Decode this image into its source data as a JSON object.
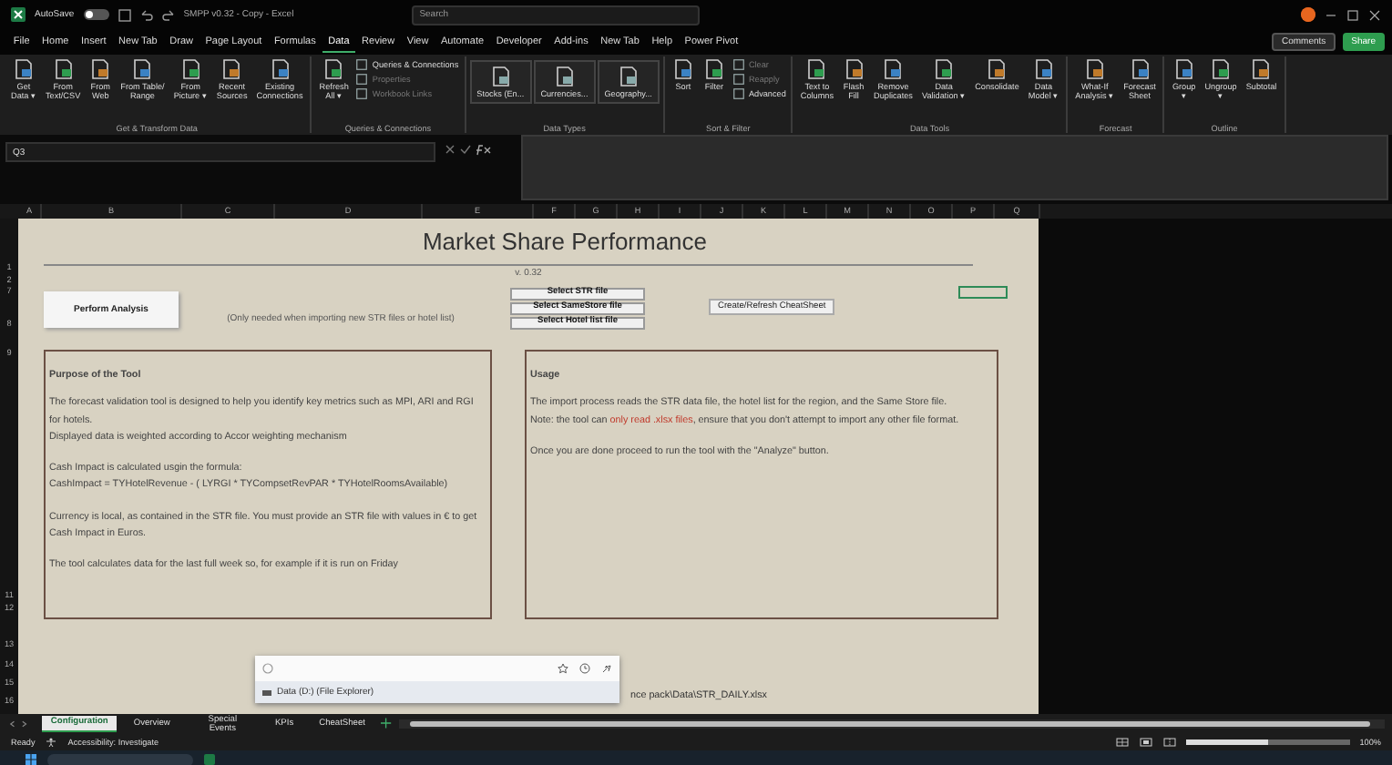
{
  "title_bar": {
    "autosave": {
      "label": "AutoSave",
      "on": false
    },
    "title": "SMPP v0.32 - Copy - Excel",
    "search": {
      "placeholder": "Search"
    }
  },
  "menu": {
    "tabs": [
      {
        "label": "File",
        "selected": false
      },
      {
        "label": "Home",
        "selected": false
      },
      {
        "label": "Insert",
        "selected": false
      },
      {
        "label": "New Tab",
        "selected": false
      },
      {
        "label": "Draw",
        "selected": false
      },
      {
        "label": "Page Layout",
        "selected": false
      },
      {
        "label": "Formulas",
        "selected": false
      },
      {
        "label": "Data",
        "selected": true
      },
      {
        "label": "Review",
        "selected": false
      },
      {
        "label": "View",
        "selected": false
      },
      {
        "label": "Automate",
        "selected": false
      },
      {
        "label": "Developer",
        "selected": false
      },
      {
        "label": "Add-ins",
        "selected": false
      },
      {
        "label": "New Tab",
        "selected": false
      },
      {
        "label": "Help",
        "selected": false
      },
      {
        "label": "Power Pivot",
        "selected": false
      }
    ],
    "comments": "Comments",
    "share": "Share"
  },
  "ribbon": {
    "groups": [
      {
        "label": "Get & Transform Data",
        "items": [
          {
            "kind": "large",
            "label": "Get\nData ▾",
            "disabled": false
          },
          {
            "kind": "large",
            "label": "From\nText/CSV",
            "disabled": false
          },
          {
            "kind": "large",
            "label": "From\nWeb",
            "disabled": false
          },
          {
            "kind": "large",
            "label": "From Table/\nRange",
            "disabled": false
          },
          {
            "kind": "large",
            "label": "From\nPicture ▾",
            "disabled": false
          },
          {
            "kind": "large",
            "label": "Recent\nSources",
            "disabled": false
          },
          {
            "kind": "large",
            "label": "Existing\nConnections",
            "disabled": false
          }
        ]
      },
      {
        "label": "Queries & Connections",
        "items": [
          {
            "kind": "large",
            "label": "Refresh\nAll ▾",
            "disabled": false
          },
          {
            "kind": "small",
            "label": "Queries & Connections",
            "disabled": false
          },
          {
            "kind": "small",
            "label": "Properties",
            "disabled": true
          },
          {
            "kind": "small",
            "label": "Workbook Links",
            "disabled": true
          }
        ]
      },
      {
        "label": "Data Types",
        "items": [
          {
            "kind": "tile",
            "label": "Stocks (En...",
            "disabled": false
          },
          {
            "kind": "tile",
            "label": "Currencies...",
            "disabled": false
          },
          {
            "kind": "tile",
            "label": "Geography...",
            "disabled": false
          }
        ]
      },
      {
        "label": "Sort & Filter",
        "items": [
          {
            "kind": "large",
            "label": "Sort",
            "disabled": false
          },
          {
            "kind": "large",
            "label": "Filter",
            "disabled": false
          },
          {
            "kind": "small",
            "label": "Clear",
            "disabled": true
          },
          {
            "kind": "small",
            "label": "Reapply",
            "disabled": true
          },
          {
            "kind": "small",
            "label": "Advanced",
            "disabled": false
          }
        ]
      },
      {
        "label": "Data Tools",
        "items": [
          {
            "kind": "large",
            "label": "Text to\nColumns",
            "disabled": false
          },
          {
            "kind": "large",
            "label": "Flash\nFill",
            "disabled": false
          },
          {
            "kind": "large",
            "label": "Remove\nDuplicates",
            "disabled": false
          },
          {
            "kind": "large",
            "label": "Data\nValidation ▾",
            "disabled": false
          },
          {
            "kind": "large",
            "label": "Consolidate",
            "disabled": false
          },
          {
            "kind": "large",
            "label": "Data\nModel ▾",
            "disabled": false
          }
        ]
      },
      {
        "label": "Forecast",
        "items": [
          {
            "kind": "large",
            "label": "What-If\nAnalysis ▾",
            "disabled": false
          },
          {
            "kind": "large",
            "label": "Forecast\nSheet",
            "disabled": false
          }
        ]
      },
      {
        "label": "Outline",
        "items": [
          {
            "kind": "large",
            "label": "Group\n▾",
            "disabled": false
          },
          {
            "kind": "large",
            "label": "Ungroup\n▾",
            "disabled": false
          },
          {
            "kind": "large",
            "label": "Subtotal",
            "disabled": false
          }
        ]
      }
    ]
  },
  "formula_bar": {
    "name_box": "Q3"
  },
  "columns": [
    "A",
    "B",
    "C",
    "D",
    "E",
    "F",
    "G",
    "H",
    "I",
    "J",
    "K",
    "L",
    "M",
    "N",
    "O",
    "P",
    "Q"
  ],
  "rows": [
    "1",
    "2",
    "7",
    "8",
    "9",
    "11",
    "12",
    "13",
    "14",
    "15",
    "16"
  ],
  "sheet": {
    "title": "Market Share Performance",
    "version": "v. 0.32",
    "perform_button": "Perform Analysis",
    "import_note": "(Only needed when importing new STR files or hotel list)",
    "select_buttons": [
      "Select STR file",
      "Select SameStore file",
      "Select Hotel list file"
    ],
    "cheatsheet_button": "Create/Refresh CheatSheet",
    "purpose": {
      "heading": "Purpose of the Tool",
      "paragraphs": [
        [
          "The forecast validation tool is designed to help you identify key metrics such as MPI, ARI and RGI for hotels.",
          "Displayed data is weighted according to Accor weighting mechanism"
        ],
        [
          "Cash Impact is calculated usgin the formula:",
          "CashImpact = TYHotelRevenue - ( LYRGI * TYCompsetRevPAR * TYHotelRoomsAvailable)"
        ],
        [
          "Currency is local, as contained in the STR file. You must provide an STR file with values in € to get Cash Impact in Euros."
        ],
        [
          "The tool calculates data for the last full week so, for example if it is run on Friday"
        ]
      ]
    },
    "usage": {
      "heading": "Usage",
      "paragraphs": [
        [
          [
            {
              "kind": "plain",
              "text": "The import process  reads the STR data file, the hotel list for the region, and the Same Store file."
            }
          ],
          [
            {
              "kind": "plain",
              "text": "Note: the tool can "
            },
            {
              "kind": "highlight",
              "text": "only read .xlsx files"
            },
            {
              "kind": "plain",
              "text": ", ensure that you don't attempt to import any other file format."
            }
          ]
        ],
        [
          [
            {
              "kind": "plain",
              "text": "Once you are done proceed to run the tool with the \"Analyze\" button."
            }
          ]
        ]
      ]
    },
    "path_text": "nce pack\\Data\\STR_DAILY.xlsx"
  },
  "popup": {
    "item": "Data (D:) (File Explorer)"
  },
  "sheet_tabs": [
    {
      "label": "Configuration",
      "selected": true
    },
    {
      "label": "Overview",
      "selected": false
    },
    {
      "label": "Special Events",
      "selected": false
    },
    {
      "label": "KPIs",
      "selected": false
    },
    {
      "label": "CheatSheet",
      "selected": false
    }
  ],
  "status_bar": {
    "ready": "Ready",
    "accessibility": "Accessibility: Investigate",
    "zoom": {
      "level": 0.5,
      "reading": "100%"
    }
  }
}
